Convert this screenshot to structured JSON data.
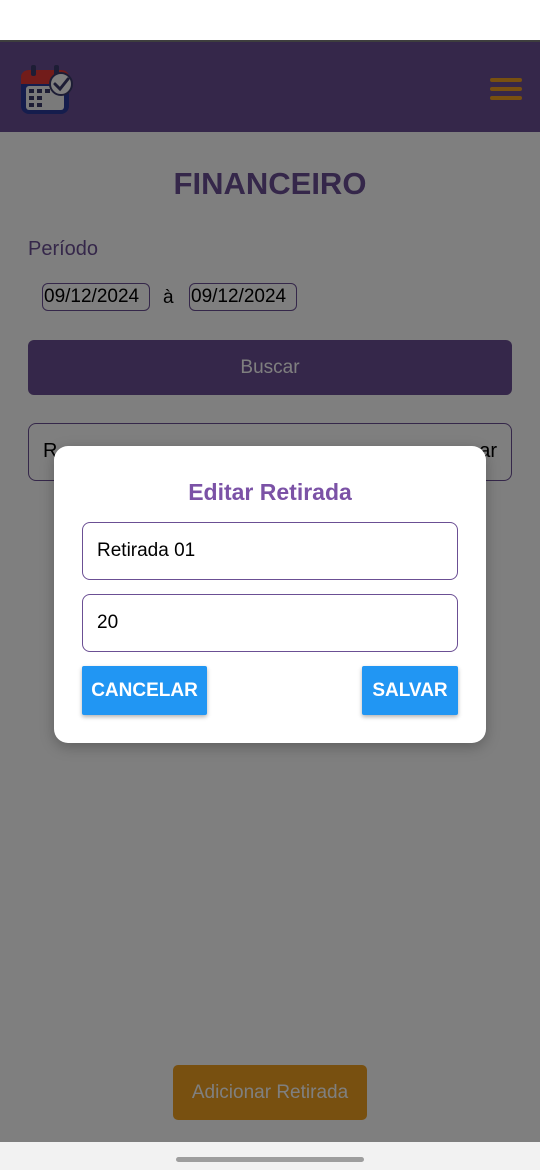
{
  "header": {
    "logo_icon": "calendar-check-icon",
    "menu_icon": "hamburger-menu-icon"
  },
  "page": {
    "title": "FINANCEIRO",
    "period_label": "Período",
    "date_from": "09/12/2024",
    "date_separator": "à",
    "date_to": "09/12/2024",
    "search_button": "Buscar",
    "add_button": "Adicionar Retirada"
  },
  "list": {
    "row": {
      "col1": "R",
      "col2": "",
      "col3": "ar"
    }
  },
  "modal": {
    "title": "Editar Retirada",
    "name_value": "Retirada 01",
    "amount_value": "20",
    "cancel_button": "CANCELAR",
    "save_button": "SALVAR"
  },
  "colors": {
    "primary": "#6b4f94",
    "accent": "#f0a020",
    "button_blue": "#2196f3",
    "modal_title": "#7b52a6"
  }
}
